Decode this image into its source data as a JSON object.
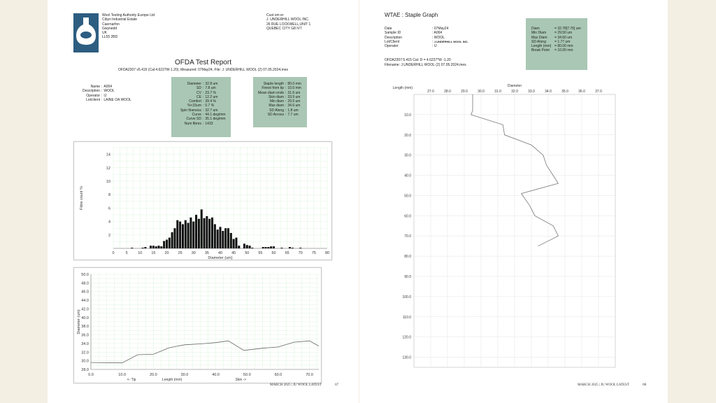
{
  "left": {
    "lab": {
      "name": "Wool Testing Authority Europe Ltd",
      "address": [
        "Cibyn Industrial Estate",
        "Caernarfon",
        "Gwynedd",
        "UK",
        "LL55 2BD"
      ]
    },
    "customer": {
      "label": "Cust om er",
      "lines": [
        "J. UNDERHILL WOOL INC.",
        "26 RUE LOCKWELL,UNIT 1",
        "QUEBEC CITY G8 IV7"
      ]
    },
    "title": "OFDA Test Report",
    "subtitle": "OFDA2307 v5.415 (Cal:4.6227W-1.20), Measured: 07May24, File: J. UNDERHILL WOOL (2) 07.05.2024.mes",
    "info": [
      {
        "label": "Name",
        "value": "A004"
      },
      {
        "label": "Description",
        "value": "WOOL"
      },
      {
        "label": "Operator",
        "value": "IJ"
      },
      {
        "label": "Lot/client",
        "value": "LAINE OA WOOL"
      }
    ],
    "stats1": [
      {
        "label": "Diameter",
        "value": "32.8 um"
      },
      {
        "label": "SD",
        "value": "7.8  um"
      },
      {
        "label": "CV",
        "value": "23.7  %"
      },
      {
        "label": "CE",
        "value": "12.2 um"
      },
      {
        "label": "Comfort",
        "value": "39.4 %"
      },
      {
        "label": "%<15um",
        "value": "0.7 %"
      },
      {
        "label": "Spin fineness",
        "value": "32.7 um"
      },
      {
        "label": "Curve",
        "value": "44.1 deg/mm"
      },
      {
        "label": "Curve SD",
        "value": "35.1 deg/mm"
      },
      {
        "label": "Num fibres",
        "value": "1433"
      }
    ],
    "stats2": [
      {
        "label": "Staple length",
        "value": "80.0 mm"
      },
      {
        "label": "Finest from tip",
        "value": "10.0 mm"
      },
      {
        "label": "Mean diam ends",
        "value": "31.6 um"
      },
      {
        "label": "Skin diam",
        "value": "33.5 um"
      },
      {
        "label": "Min diam",
        "value": "29.5 um"
      },
      {
        "label": "Max diam",
        "value": "34.6 um"
      },
      {
        "label": "SD Along",
        "value": "1.8 um"
      },
      {
        "label": "SD Across",
        "value": "7.7 um"
      }
    ],
    "footer": {
      "text": "MARCH 2025 | JU WOOL LATEST",
      "page": "07"
    }
  },
  "right": {
    "title": "WTAE : Staple Graph",
    "info": [
      {
        "label": "Date",
        "value": "07May24"
      },
      {
        "label": "Sample ID",
        "value": "A004"
      },
      {
        "label": "Description",
        "value": "WOOL"
      },
      {
        "label": "Lot/Client",
        "value": "J.UNDERHILL WOOL INC."
      },
      {
        "label": "Operator",
        "value": "IJ"
      }
    ],
    "cal": "OFDA2307:5.415 Cal: D = 4.6227*W -1.20",
    "filename_label": "Filename:",
    "filename": "J.UNDERHILL WOOL (2) 07.05.2024.mes",
    "stats": [
      {
        "label": "Diam",
        "value": "32.78[7.76] um"
      },
      {
        "label": "Min Diam",
        "value": "29.50 um"
      },
      {
        "label": "Max Diam",
        "value": "34.60 um"
      },
      {
        "label": "SD Along",
        "value": "1.77 um"
      },
      {
        "label": "Length (mm)",
        "value": "80.00 mm"
      },
      {
        "label": "Break Point",
        "value": "10.00 mm"
      }
    ],
    "footer": {
      "text": "MARCH 2025 | JU WOOL LATEST",
      "page": "08"
    }
  },
  "chart_data": [
    {
      "type": "bar",
      "ylabel": "Fibre count %",
      "xlabel": "Diameter (um)",
      "xlim": [
        0,
        80
      ],
      "ylim": [
        0,
        15
      ],
      "xticks": [
        "0",
        "5",
        "10",
        "15",
        "20",
        "25",
        "30",
        "35",
        "40",
        "45",
        "50",
        "55",
        "60",
        "65",
        "70",
        "75",
        "80"
      ],
      "yticks": [
        "2",
        "4",
        "6",
        "8",
        "10",
        "12",
        "14"
      ],
      "x": [
        7,
        11,
        12,
        14,
        15,
        16,
        17,
        18,
        19,
        20,
        21,
        22,
        23,
        24,
        25,
        26,
        27,
        28,
        29,
        30,
        31,
        32,
        33,
        34,
        35,
        36,
        37,
        38,
        39,
        40,
        41,
        42,
        43,
        44,
        45,
        46,
        47,
        49,
        50,
        51,
        52,
        56,
        57,
        58,
        59,
        60,
        63,
        66,
        67,
        70
      ],
      "values": [
        0.1,
        0.1,
        0.2,
        0.4,
        0.4,
        0.3,
        0.4,
        0.3,
        1.1,
        1.3,
        1.6,
        2.4,
        3.0,
        4.2,
        4.0,
        3.6,
        4.2,
        3.8,
        4.6,
        4.0,
        5.0,
        4.4,
        5.8,
        4.5,
        4.8,
        4.4,
        4.6,
        3.6,
        2.8,
        3.2,
        2.6,
        3.0,
        3.0,
        2.3,
        1.4,
        1.6,
        0.4,
        0.7,
        0.5,
        0.4,
        0.1,
        0.2,
        0.2,
        0.2,
        0.3,
        0.3,
        0.1,
        0.2,
        0.1,
        0.1
      ],
      "grid": true
    },
    {
      "type": "line",
      "ylabel": "Diameter (um)",
      "xlabel": "Length (mm)",
      "annotations": [
        "<- Tip",
        "Skin ->"
      ],
      "xlim": [
        0,
        73
      ],
      "ylim": [
        28,
        50
      ],
      "xticks": [
        "0.0",
        "10.0",
        "20.0",
        "30.0",
        "40.0",
        "50.0",
        "60.0",
        "70.0"
      ],
      "yticks": [
        "28.0",
        "30.0",
        "32.0",
        "34.0",
        "36.0",
        "38.0",
        "40.0",
        "42.0",
        "44.0",
        "46.0",
        "48.0",
        "50.0"
      ],
      "x": [
        0,
        10,
        15,
        20,
        25,
        30,
        35,
        40,
        44,
        49,
        55,
        60,
        65,
        70,
        73
      ],
      "values": [
        29.6,
        29.5,
        31.4,
        31.5,
        33.0,
        33.7,
        33.9,
        34.2,
        34.6,
        32.4,
        32.9,
        33.2,
        34.3,
        34.6,
        33.4
      ],
      "grid": true
    },
    {
      "type": "line",
      "orientation": "vertical",
      "xlabel": "Diameter",
      "ylabel": "Length (mm)",
      "xlim": [
        26,
        38
      ],
      "ylim": [
        0,
        135
      ],
      "xticks": [
        "27.0",
        "28.0",
        "29.0",
        "30.0",
        "31.0",
        "32.0",
        "33.0",
        "34.0",
        "35.0",
        "36.0",
        "37.0"
      ],
      "yticks": [
        "10.0",
        "20.0",
        "30.0",
        "40.0",
        "50.0",
        "60.0",
        "70.0",
        "80.0",
        "90.0",
        "100.0",
        "110.0",
        "120.0",
        "130.0"
      ],
      "diameter": [
        29.5,
        29.5,
        29.4,
        31.3,
        31.4,
        33.0,
        33.7,
        33.9,
        34.6,
        32.4,
        32.9,
        33.2,
        34.3,
        34.6,
        33.4
      ],
      "length": [
        0,
        8,
        10,
        15,
        20,
        25,
        30,
        35,
        44,
        49,
        55,
        60,
        65,
        70,
        75
      ],
      "grid": true
    }
  ]
}
